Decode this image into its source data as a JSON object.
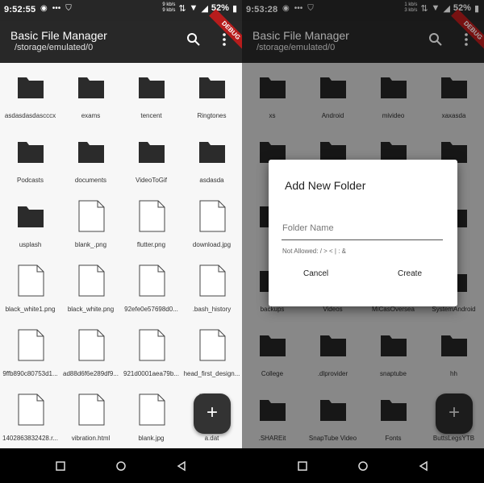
{
  "left": {
    "status": {
      "time": "9:52:55",
      "speed_top": "9 kb/s",
      "speed_bottom": "9 kb/s",
      "battery": "52%"
    },
    "appbar": {
      "title": "Basic File Manager",
      "path": "/storage/emulated/0",
      "ribbon": "DEBUG"
    },
    "items": [
      {
        "name": "asdasdasdascccx",
        "type": "folder"
      },
      {
        "name": "exams",
        "type": "folder"
      },
      {
        "name": "tencent",
        "type": "folder"
      },
      {
        "name": "Ringtones",
        "type": "folder"
      },
      {
        "name": "Podcasts",
        "type": "folder"
      },
      {
        "name": "documents",
        "type": "folder"
      },
      {
        "name": "VideoToGif",
        "type": "folder"
      },
      {
        "name": "asdasda",
        "type": "folder"
      },
      {
        "name": "usplash",
        "type": "folder"
      },
      {
        "name": "blank_.png",
        "type": "file"
      },
      {
        "name": "flutter.png",
        "type": "file"
      },
      {
        "name": "download.jpg",
        "type": "file"
      },
      {
        "name": "black_white1.png",
        "type": "file"
      },
      {
        "name": "black_white.png",
        "type": "file"
      },
      {
        "name": "92efe0e57698d0...",
        "type": "file"
      },
      {
        "name": ".bash_history",
        "type": "file"
      },
      {
        "name": "9ffb890c80753d1...",
        "type": "file"
      },
      {
        "name": "ad88d6f6e289df9...",
        "type": "file"
      },
      {
        "name": "921d0001aea79b...",
        "type": "file"
      },
      {
        "name": "head_first_design...",
        "type": "file"
      },
      {
        "name": "1402863832428.r...",
        "type": "file"
      },
      {
        "name": "vibration.html",
        "type": "file"
      },
      {
        "name": "blank.jpg",
        "type": "file"
      },
      {
        "name": "a.dat",
        "type": "file"
      }
    ],
    "fab": "+"
  },
  "right": {
    "status": {
      "time": "9:53:28",
      "speed_top": "1 kb/s",
      "speed_bottom": "3 kb/s",
      "battery": "52%"
    },
    "appbar": {
      "title": "Basic File Manager",
      "path": "/storage/emulated/0",
      "ribbon": "DEBUG"
    },
    "items": [
      {
        "name": "xs",
        "type": "folder"
      },
      {
        "name": "Android",
        "type": "folder"
      },
      {
        "name": "mivideo",
        "type": "folder"
      },
      {
        "name": "xaxasda",
        "type": "folder"
      },
      {
        "name": "",
        "type": "folder"
      },
      {
        "name": "",
        "type": "folder"
      },
      {
        "name": "",
        "type": "folder"
      },
      {
        "name": "",
        "type": "folder"
      },
      {
        "name": "",
        "type": "folder"
      },
      {
        "name": "",
        "type": "folder"
      },
      {
        "name": "",
        "type": "folder"
      },
      {
        "name": "",
        "type": "folder"
      },
      {
        "name": "backups",
        "type": "folder"
      },
      {
        "name": "Videos",
        "type": "folder"
      },
      {
        "name": "MiCasOversea",
        "type": "folder"
      },
      {
        "name": "SystemAndroid",
        "type": "folder"
      },
      {
        "name": "College",
        "type": "folder"
      },
      {
        "name": ".dlprovider",
        "type": "folder"
      },
      {
        "name": "snaptube",
        "type": "folder"
      },
      {
        "name": "hh",
        "type": "folder"
      },
      {
        "name": ".SHAREit",
        "type": "folder"
      },
      {
        "name": "SnapTube Video",
        "type": "folder"
      },
      {
        "name": "Fonts",
        "type": "folder"
      },
      {
        "name": "ButtsLegsYTB",
        "type": "folder"
      }
    ],
    "fab": "+",
    "dialog": {
      "title": "Add New Folder",
      "placeholder": "Folder Name",
      "hint": "Not Allowed: / > < | : &",
      "cancel": "Cancel",
      "create": "Create"
    }
  },
  "colors": {
    "appbar": "#282828",
    "statusbar": "#272727",
    "folder": "#2b2b2b",
    "ribbon": "#b71c1c"
  }
}
